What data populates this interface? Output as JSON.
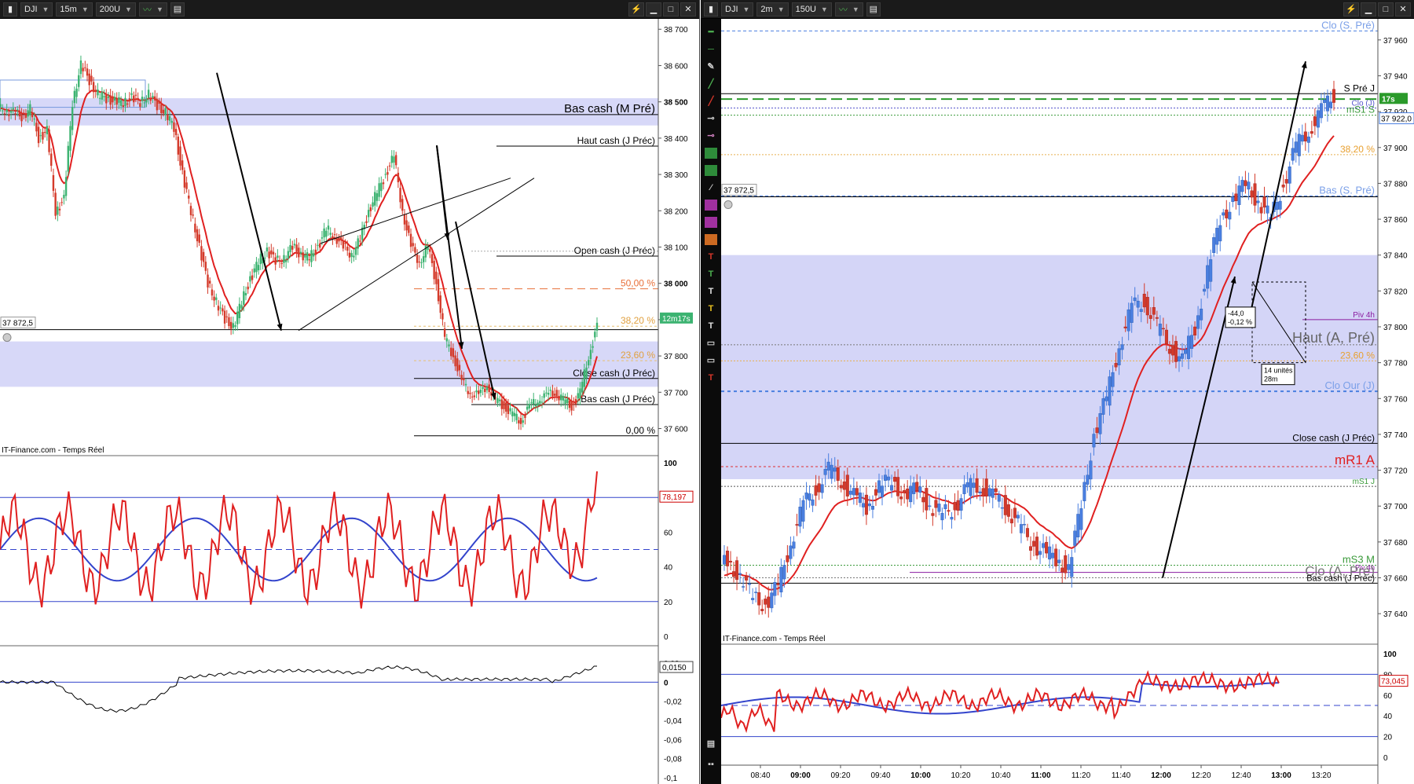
{
  "left": {
    "toolbar": {
      "symbol": "DJI",
      "timeframe": "15m",
      "units": "200U"
    },
    "price_axis": [
      "38 700",
      "38 600",
      "38 500",
      "38 400",
      "38 300",
      "38 200",
      "38 100",
      "38 000",
      "37 900",
      "37 800",
      "37 700",
      "37 600"
    ],
    "levels": [
      {
        "label": "Bas cash (M Pré)"
      },
      {
        "label": "Haut cash (J Préc)"
      },
      {
        "label": "Open cash (J Préc)"
      },
      {
        "label": "50,00 %"
      },
      {
        "label": "38,20 %"
      },
      {
        "label": "23,60 %"
      },
      {
        "label": "Close cash (J Préc)"
      },
      {
        "label": "Bas cash (J Préc)"
      },
      {
        "label": "0,00 %"
      }
    ],
    "price_tag": "37 872,5",
    "timer_badge": "12m17s",
    "source": "IT-Finance.com - Temps Réel",
    "osc1": {
      "axis": [
        "100",
        "60",
        "40",
        "20",
        "0"
      ],
      "value": "78,197"
    },
    "osc2": {
      "axis": [
        "0,02",
        "0",
        "-0,02",
        "-0,04",
        "-0,06",
        "-0,08",
        "-0,1"
      ],
      "value": "0,0150"
    }
  },
  "right": {
    "toolbar": {
      "symbol": "DJI",
      "timeframe": "2m",
      "units": "150U"
    },
    "price_axis": [
      "37 960",
      "37 940",
      "37 920",
      "37 900",
      "37 880",
      "37 860",
      "37 840",
      "37 820",
      "37 800",
      "37 780",
      "37 760",
      "37 740",
      "37 720",
      "37 700",
      "37 680",
      "37 660",
      "37 640"
    ],
    "levels": [
      {
        "label": "Clo (S. Pré)"
      },
      {
        "label": "S Pré J"
      },
      {
        "label": "Clo (J)"
      },
      {
        "label": "mS1 S"
      },
      {
        "label": "38,20 %"
      },
      {
        "label": "Bas (S. Pré)"
      },
      {
        "label": "Piv 4h"
      },
      {
        "label": "Haut (A, Pré)"
      },
      {
        "label": "23,60 %"
      },
      {
        "label": "Clo Our (J)"
      },
      {
        "label": "Close cash (J Préc)"
      },
      {
        "label": "mR1 A"
      },
      {
        "label": "mS1 J"
      },
      {
        "label": "mS3 M"
      },
      {
        "label": "Piv 4h"
      },
      {
        "label": "Clo (A, Pré)"
      },
      {
        "label": "Bas cash (J Préc)"
      }
    ],
    "price_tag": "37 872,5",
    "timer_badge": "17s",
    "last_price": "37 922,0",
    "annotation_move": [
      "-44,0",
      "-0,12 %"
    ],
    "annotation_bars": [
      "14 unités",
      "28m"
    ],
    "source": "IT-Finance.com - Temps Réel",
    "osc1": {
      "axis": [
        "100",
        "80",
        "60",
        "40",
        "20",
        "0"
      ],
      "value": "73,045"
    },
    "time_axis": [
      "08:40",
      "09:00",
      "09:20",
      "09:40",
      "10:00",
      "10:20",
      "10:40",
      "11:00",
      "11:20",
      "11:40",
      "12:00",
      "12:20",
      "12:40",
      "13:00",
      "13:20"
    ]
  },
  "colors": {
    "up": "#3cb371",
    "down": "#d43a2a",
    "up_r": "#4a7fe0",
    "ma": "#e02020",
    "osc_blue": "#3344cc",
    "zone": "#c9cbf5"
  },
  "chart_data": [
    {
      "type": "candlestick",
      "title": "DJI 15m",
      "ylim": [
        37560,
        38720
      ],
      "ma_line": "red",
      "price_zones": [
        [
          37715,
          37840
        ],
        [
          38435,
          38510
        ]
      ],
      "series": [
        {
          "values": [
            38480,
            38470,
            38460,
            38480,
            38400,
            38420,
            38200,
            38230,
            38500,
            38600,
            38560,
            38520,
            38510,
            38500,
            38500,
            38510,
            38500,
            38520,
            38490,
            38470,
            38430,
            38300,
            38200,
            38100,
            38000,
            37950,
            37900,
            37880,
            37950,
            38010,
            38060,
            38090,
            38060,
            38070,
            38100,
            38080,
            38070,
            38100,
            38150,
            38130,
            38100,
            38080,
            38120,
            38200,
            38250,
            38300,
            38350,
            38200,
            38100,
            38060,
            38100,
            38000,
            37850,
            37800,
            37730,
            37700,
            37690,
            37720,
            37680,
            37660,
            37640,
            37620,
            37660,
            37680,
            37690,
            37700,
            37680,
            37660,
            37700,
            37800,
            37880
          ]
        }
      ]
    },
    {
      "type": "candlestick",
      "title": "DJI 2m",
      "ylim": [
        37630,
        37970
      ],
      "ma_line": "red",
      "price_zones": [
        [
          37715,
          37840
        ]
      ],
      "series": [
        {
          "values": [
            37670,
            37660,
            37650,
            37645,
            37655,
            37680,
            37700,
            37710,
            37720,
            37715,
            37705,
            37700,
            37710,
            37715,
            37705,
            37710,
            37700,
            37695,
            37700,
            37710,
            37712,
            37705,
            37700,
            37690,
            37680,
            37675,
            37670,
            37665,
            37700,
            37740,
            37760,
            37790,
            37810,
            37815,
            37800,
            37790,
            37780,
            37800,
            37830,
            37860,
            37870,
            37880,
            37870,
            37860,
            37880,
            37900,
            37910,
            37920,
            37930
          ]
        }
      ]
    }
  ]
}
